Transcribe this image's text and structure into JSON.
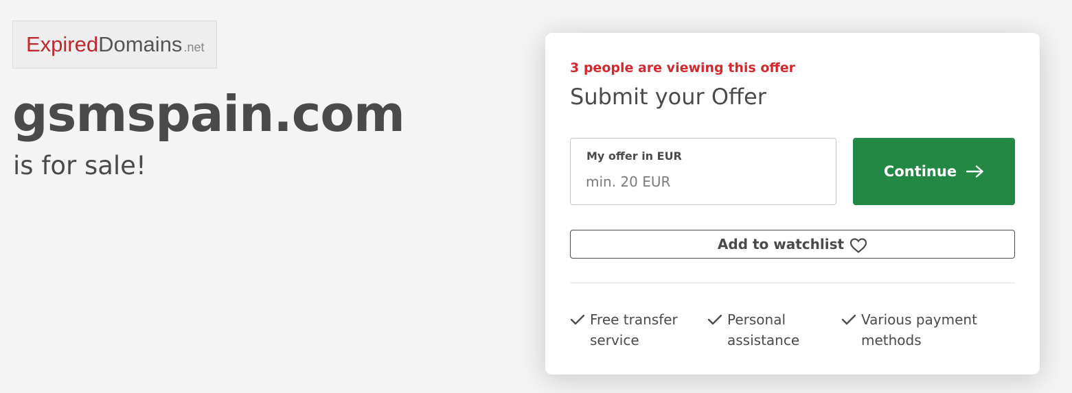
{
  "logo": {
    "part1": "Expired",
    "part2": "Domains",
    "part3": ".net",
    "colors": {
      "red": "#c0282d",
      "gray": "#555555",
      "light": "#888888"
    }
  },
  "domain": {
    "name": "gsmspain.com",
    "tagline": "is for sale!"
  },
  "offer_card": {
    "viewers_text": "3 people are viewing this offer",
    "title": "Submit your Offer",
    "offer_field": {
      "label": "My offer in EUR",
      "value": "",
      "placeholder": "min. 20 EUR"
    },
    "continue_label": "Continue",
    "continue_icon": "arrow-right-icon",
    "watchlist_label": "Add to watchlist",
    "watchlist_icon": "heart-icon",
    "features": [
      {
        "icon": "check-icon",
        "text": "Free transfer\nservice"
      },
      {
        "icon": "check-icon",
        "text": "Personal\nassistance"
      },
      {
        "icon": "check-icon",
        "text": "Various payment\nmethods"
      }
    ]
  },
  "colors": {
    "accent_green": "#228844",
    "alert_red": "#d4282d",
    "text": "#4a4a4a",
    "background": "#f4f4f4"
  }
}
